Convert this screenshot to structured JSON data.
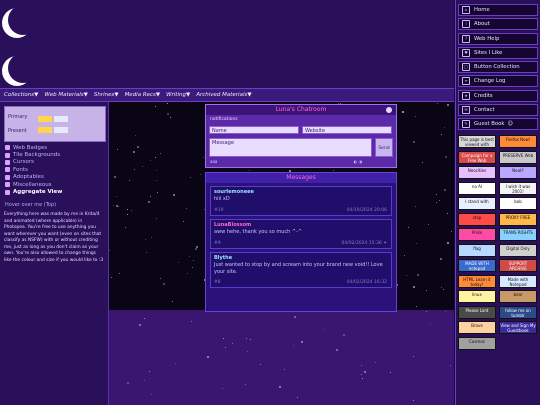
{
  "topnav": [
    "Collections▼",
    "Web Materials▼",
    "Shrines▼",
    "Media Recs▼",
    "Writing▼",
    "Archived Materials▼"
  ],
  "palette": {
    "primary_label": "Primary",
    "present_label": "Present",
    "colors": [
      "#ffd54a",
      "#e8e8ff",
      "#ffd54a"
    ]
  },
  "leftlinks": [
    "Web Badges",
    "Tile Backgrounds",
    "Cursors",
    "Fonts",
    "Adoptables",
    "Miscellaneous",
    "Aggregate View"
  ],
  "hover_hint": "Hover over me (Top)",
  "blurb": "Everything here was made by me in Krita/4 and animated (where applicable) in Photopea. You're free to use anything you want wherever you want (even on sites that classify as NSFW) with or without crediting me, just as long as you don't claim as your own. You're also allowed to change things like the colour and size if you would like to :3",
  "chat": {
    "title": "Luna's Chatroom",
    "notify": "notifications",
    "name_placeholder": "Name",
    "website_placeholder": "Website",
    "message_placeholder": "Message",
    "send_label": "Send",
    "footer_left": "aaa",
    "footer_right": "◐ ◑"
  },
  "messages_title": "Messages",
  "messages": [
    {
      "name": "sourlemoneee",
      "text": "hiii xD",
      "num": "#19",
      "date": "04/19/2024 20:06"
    },
    {
      "name": "LunaBlossom",
      "text": "aww hehe, thank you so much ^-^",
      "num": "#9",
      "date": "04/02/2024 15:36 ✦"
    },
    {
      "name": "Blythe",
      "text": "Just wanted to stop by and scream into your brand new void!! Love your site.",
      "num": "#8",
      "date": "04/02/2024 16:32"
    }
  ],
  "rightnav": [
    {
      "label": "Home",
      "icon": "⌂"
    },
    {
      "label": "About",
      "icon": "i"
    },
    {
      "label": "Web Help",
      "icon": "?"
    },
    {
      "label": "Sites I Like",
      "icon": "♥"
    },
    {
      "label": "Button Collection",
      "icon": "□"
    },
    {
      "label": "Change Log",
      "icon": "≡"
    },
    {
      "label": "Credits",
      "icon": "★"
    },
    {
      "label": "Contact",
      "icon": "✉"
    },
    {
      "label": "Guest Book",
      "icon": "✎"
    }
  ],
  "guestbook_suffix": "☺",
  "badges": [
    {
      "text": "This page is best viewed with",
      "bg": "#d8d8d8"
    },
    {
      "text": "Firefox Now!",
      "bg": "#ff8a3a"
    },
    {
      "text": "Campaign for a Free Web",
      "bg": "#d94a4a"
    },
    {
      "text": "PRESERVE Web",
      "bg": "#c8c8c8"
    },
    {
      "text": "Neocities",
      "bg": "#e6c0ff"
    },
    {
      "text": "Neat?",
      "bg": "#b9a8ff"
    },
    {
      "text": "no AI",
      "bg": "#ffffff"
    },
    {
      "text": "I wish it was 2001!",
      "bg": "#f4f4f4"
    },
    {
      "text": "I stand with",
      "bg": "#e8f0ff"
    },
    {
      "text": "bob",
      "bg": "#ffffff"
    },
    {
      "text": "stop",
      "bg": "#ff4a4a"
    },
    {
      "text": "PROXY FREE",
      "bg": "#ffb84a"
    },
    {
      "text": "Pride",
      "bg": "#ff4aa8"
    },
    {
      "text": "TRANS RIGHTS",
      "bg": "#8ad0ff"
    },
    {
      "text": "flag",
      "bg": "#b8d8ff"
    },
    {
      "text": "Digital Only",
      "bg": "#d0d0d0"
    },
    {
      "text": "MADE WITH notepad",
      "bg": "#3a6ad0"
    },
    {
      "text": "SUPPORT ARCHIVE",
      "bg": "#d04a4a"
    },
    {
      "text": "HTML Learn it today!",
      "bg": "#ff8a3a"
    },
    {
      "text": "Made with Notepad",
      "bg": "#d8e8ff"
    },
    {
      "text": "linux",
      "bg": "#fff2a0"
    },
    {
      "text": "bear",
      "bg": "#c89a6a"
    },
    {
      "text": "Please Lord",
      "bg": "#4a4a4a"
    },
    {
      "text": "follow me on tumblr",
      "bg": "#2a4a8a"
    },
    {
      "text": "Brave",
      "bg": "#ffd0a0"
    },
    {
      "text": "View and Sign My Guestbook",
      "bg": "#3a2a9a"
    },
    {
      "text": "Cosmos",
      "bg": "#a0a0a0"
    }
  ]
}
